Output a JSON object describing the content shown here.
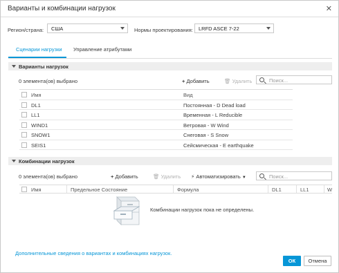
{
  "window": {
    "title": "Варианты и комбинации нагрузок"
  },
  "settings": {
    "region_label": "Регион/страна:",
    "region_value": "США",
    "code_label": "Нормы проектирования:",
    "code_value": "LRFD ASCE 7-22"
  },
  "tabs": [
    {
      "label": "Сценарии нагрузки",
      "active": true
    },
    {
      "label": "Управление атрибутами",
      "active": false
    }
  ],
  "load_cases": {
    "section_title": "Варианты нагрузок",
    "selected_count": "0 элемента(ов) выбрано",
    "add_label": "Добавить",
    "delete_label": "Удалить",
    "search_placeholder": "Поиск...",
    "columns": [
      "Имя",
      "Вид"
    ],
    "rows": [
      {
        "name": "DL1",
        "type": "Постоянная - D Dead load"
      },
      {
        "name": "LL1",
        "type": "Временная - L Reducible"
      },
      {
        "name": "WIND1",
        "type": "Ветровая - W Wind"
      },
      {
        "name": "SNOW1",
        "type": "Снеговая - S Snow"
      },
      {
        "name": "SEIS1",
        "type": "Сейсмическая - E earthquake"
      }
    ]
  },
  "combinations": {
    "section_title": "Комбинации нагрузок",
    "selected_count": "0 элемента(ов) выбрано",
    "add_label": "Добавить",
    "delete_label": "Удалить",
    "automate_label": "Автоматизировать",
    "search_placeholder": "Поиск...",
    "columns": [
      "Имя",
      "Предельное Состояние",
      "Формула",
      "DL1",
      "LL1",
      "W"
    ],
    "empty_message": "Комбинации нагрузок пока не определены."
  },
  "footer": {
    "info_link": "Дополнительные сведения о вариантах и комбинациях нагрузок.",
    "ok_label": "ОК",
    "cancel_label": "Отмена"
  },
  "colors": {
    "accent": "#0696d7"
  }
}
